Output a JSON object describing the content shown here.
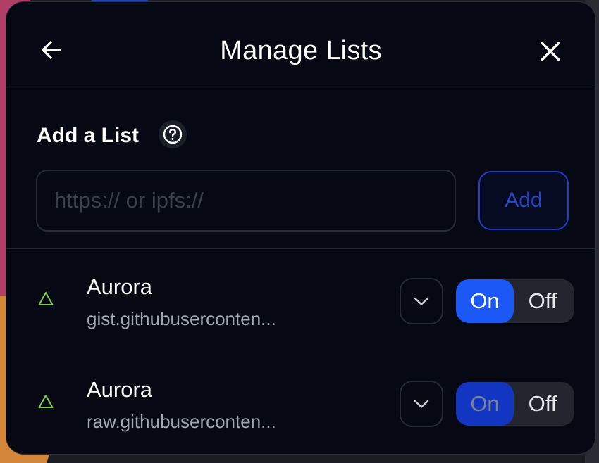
{
  "header": {
    "title": "Manage Lists",
    "back_icon": "arrow-left-icon",
    "close_icon": "close-icon"
  },
  "add_list": {
    "label": "Add a List",
    "help_icon": "question-circle-icon",
    "input_placeholder": "https:// or ipfs://",
    "input_value": "",
    "add_button_label": "Add"
  },
  "lists": [
    {
      "name": "Aurora",
      "url": "gist.githubuserconten...",
      "status_icon": "triangle-icon",
      "toggle_on": "On",
      "toggle_off": "Off",
      "enabled": true
    },
    {
      "name": "Aurora",
      "url": "raw.githubuserconten...",
      "status_icon": "triangle-icon",
      "toggle_on": "On",
      "toggle_off": "Off",
      "enabled": true
    }
  ],
  "colors": {
    "modal_bg": "#060913",
    "accent_blue": "#1c58f5",
    "status_green": "#7bd34a",
    "muted_text": "#a3a7b3"
  }
}
